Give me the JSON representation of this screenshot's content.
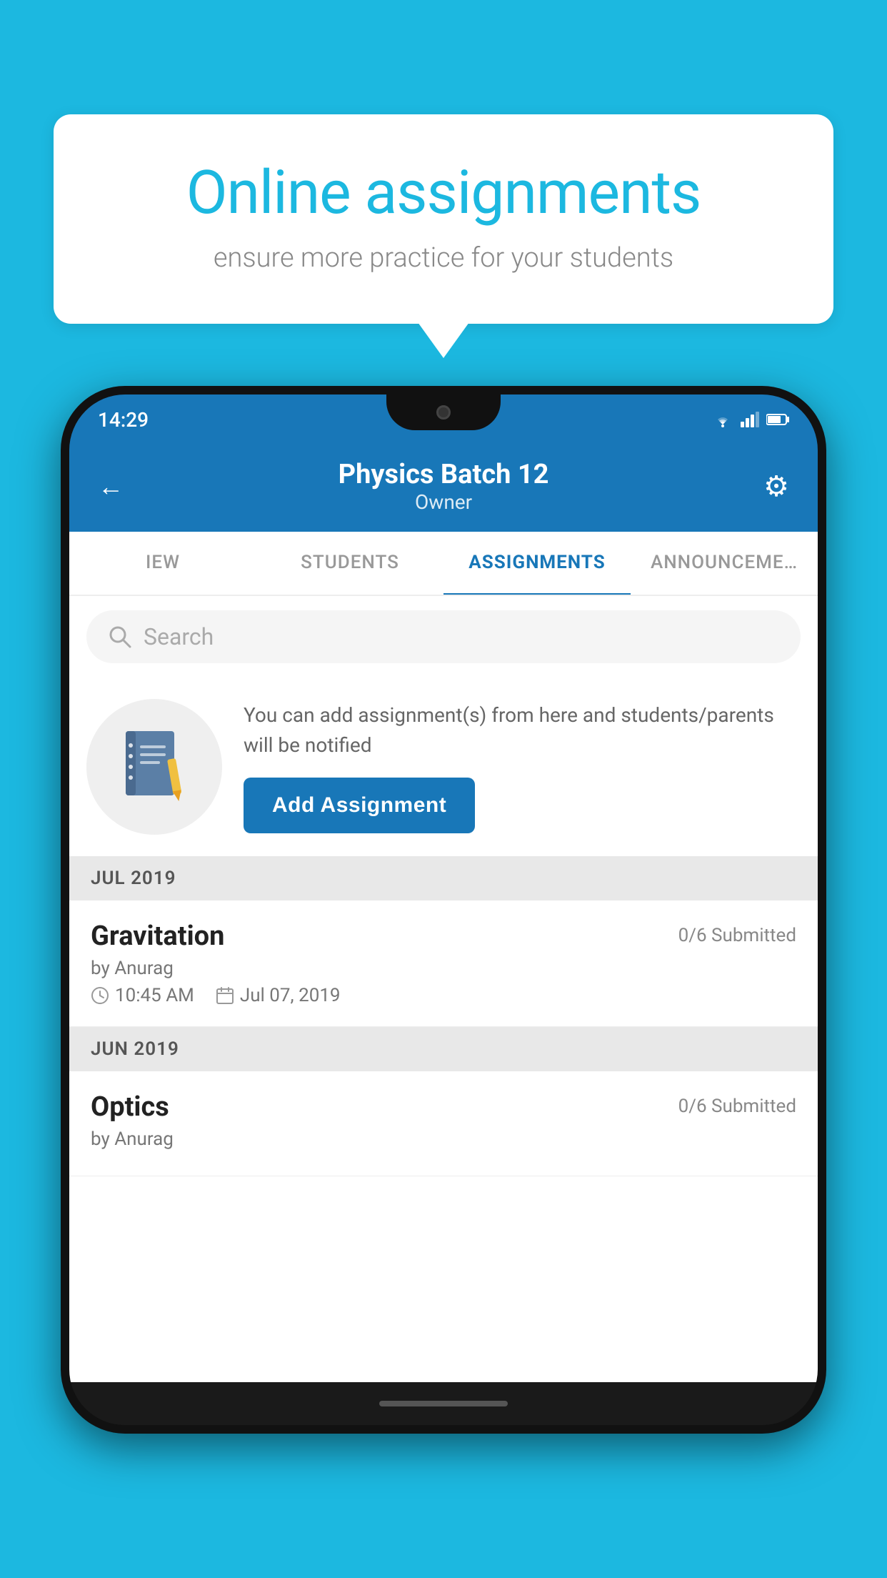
{
  "background_color": "#1cb8e0",
  "speech_bubble": {
    "title": "Online assignments",
    "subtitle": "ensure more practice for your students"
  },
  "phone": {
    "status_bar": {
      "time": "14:29",
      "icons": [
        "wifi",
        "signal",
        "battery"
      ]
    },
    "header": {
      "back_label": "←",
      "title": "Physics Batch 12",
      "subtitle": "Owner",
      "settings_label": "⚙"
    },
    "tabs": [
      {
        "label": "IEW",
        "active": false
      },
      {
        "label": "STUDENTS",
        "active": false
      },
      {
        "label": "ASSIGNMENTS",
        "active": true
      },
      {
        "label": "ANNOUNCEME…",
        "active": false
      }
    ],
    "search": {
      "placeholder": "Search"
    },
    "promo": {
      "description": "You can add assignment(s) from here and students/parents will be notified",
      "button_label": "Add Assignment"
    },
    "sections": [
      {
        "month_label": "JUL 2019",
        "assignments": [
          {
            "name": "Gravitation",
            "status": "0/6 Submitted",
            "author": "by Anurag",
            "time": "10:45 AM",
            "date": "Jul 07, 2019"
          }
        ]
      },
      {
        "month_label": "JUN 2019",
        "assignments": [
          {
            "name": "Optics",
            "status": "0/6 Submitted",
            "author": "by Anurag",
            "time": "",
            "date": ""
          }
        ]
      }
    ]
  }
}
